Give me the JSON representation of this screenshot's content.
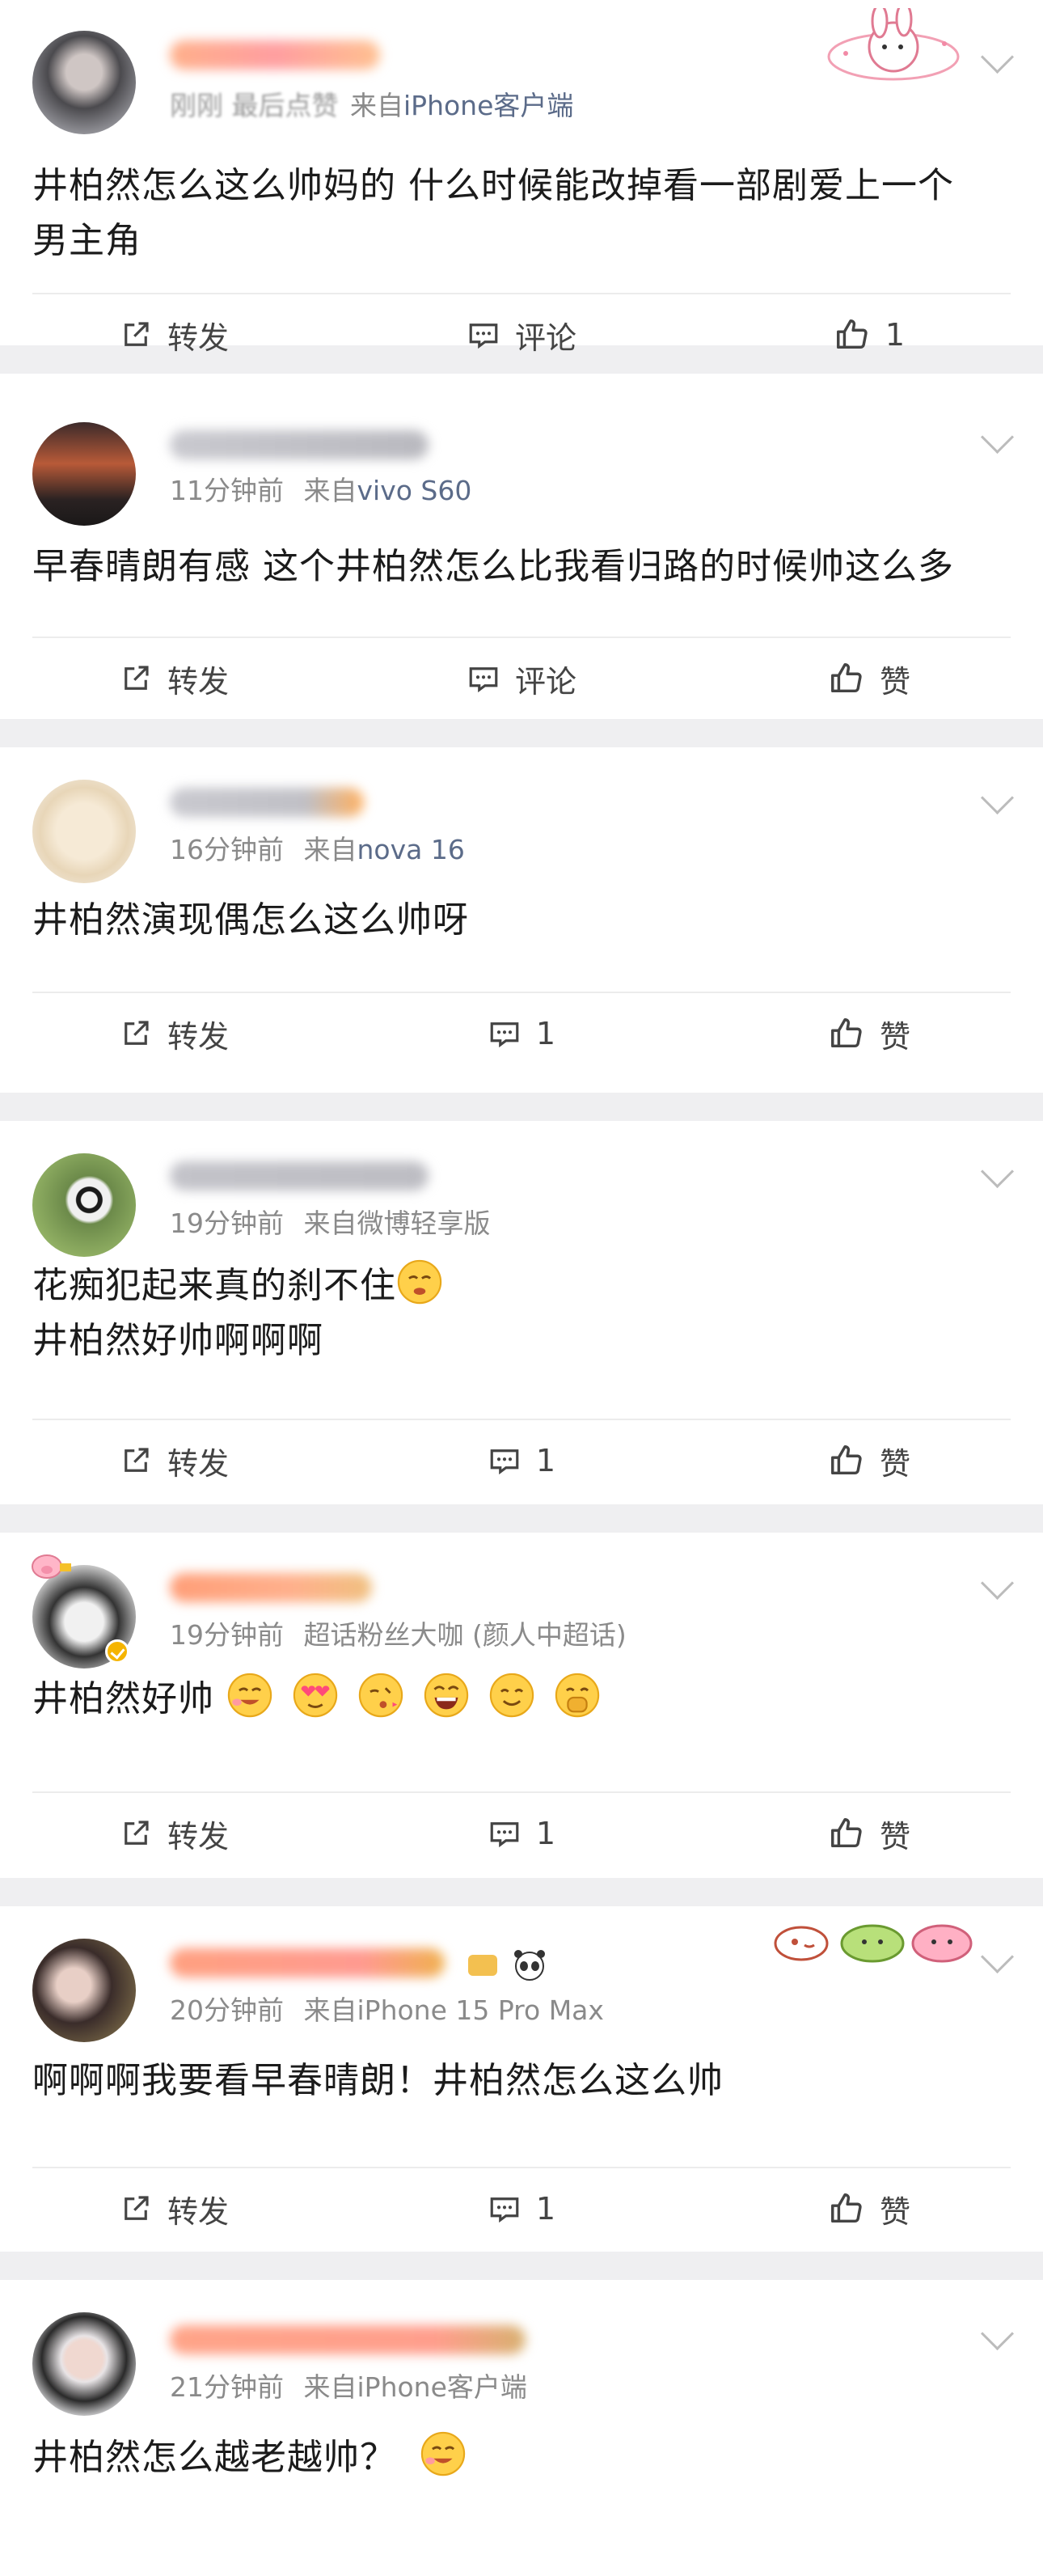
{
  "posts": [
    {
      "meta_erased": "刚刚 最后点赞",
      "meta_source": "来自",
      "meta_device": "iPhone客户端",
      "lines": [
        "井柏然怎么这么帅妈的 什么时候能改掉看一部剧爱上一个",
        "男主角"
      ],
      "repost_label": "转发",
      "comment_label": "评论",
      "like_label": "1"
    },
    {
      "meta_time": "11分钟前",
      "meta_source": "来自",
      "meta_device": "vivo S60",
      "lines": [
        "早春晴朗有感 这个井柏然怎么比我看归路的时候帅这么多"
      ],
      "repost_label": "转发",
      "comment_label": "评论",
      "like_label": "赞"
    },
    {
      "meta_time": "16分钟前",
      "meta_source": "来自",
      "meta_device": "nova 16",
      "lines": [
        "井柏然演现偶怎么这么帅呀"
      ],
      "repost_label": "转发",
      "comment_label": "1",
      "like_label": "赞"
    },
    {
      "meta_time": "19分钟前",
      "meta_source": "来自微博轻享版",
      "lines": [
        "花痴犯起来真的刹不住",
        "井柏然好帅啊啊啊"
      ],
      "repost_label": "转发",
      "comment_label": "1",
      "like_label": "赞"
    },
    {
      "meta_time": "19分钟前",
      "meta_source": "超话粉丝大咖 (颜人中超话)",
      "lines": [
        "井柏然好帅"
      ],
      "repost_label": "转发",
      "comment_label": "1",
      "like_label": "赞"
    },
    {
      "meta_time": "20分钟前",
      "meta_source": "来自",
      "meta_device": "iPhone 15 Pro Max",
      "lines": [
        "啊啊啊我要看早春晴朗！井柏然怎么这么帅"
      ],
      "repost_label": "转发",
      "comment_label": "1",
      "like_label": "赞"
    },
    {
      "meta_time": "21分钟前",
      "meta_source": "来自",
      "meta_device": "iPhone客户端",
      "lines": [
        "井柏然怎么越老越帅？"
      ]
    }
  ],
  "icons": {
    "repost": "repost-icon",
    "comment": "comment-icon",
    "like": "thumbs-up-icon",
    "more": "chevron-down-icon",
    "emoji": "emoji-icon"
  },
  "colors": {
    "background": "#efeff1",
    "card": "#ffffff",
    "text": "#1b1b1b",
    "meta": "#8a8a8a",
    "device": "#5b6b89",
    "action": "#444444",
    "vip": "#f5b400",
    "username_blur": "#ff9a6a"
  }
}
